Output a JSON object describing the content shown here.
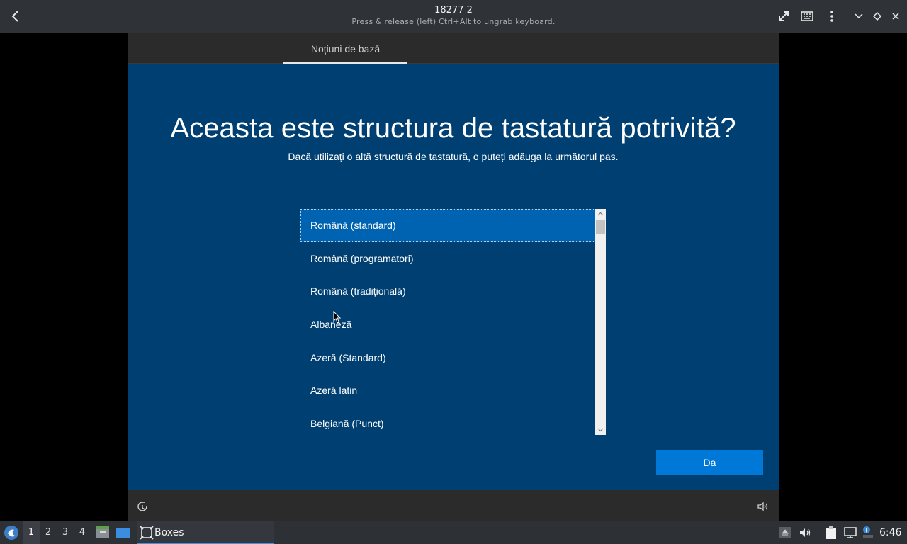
{
  "window": {
    "title": "18277 2",
    "subtitle": "Press & release (left) Ctrl+Alt to ungrab keyboard."
  },
  "setup": {
    "tab_label": "Noțiuni de bază",
    "heading": "Aceasta este structura de tastatură potrivită?",
    "subheading": "Dacă utilizați o altă structură de tastatură, o puteți adăuga la următorul pas.",
    "layouts": [
      "Română (standard)",
      "Română (programatori)",
      "Română (tradițională)",
      "Albaneză",
      "Azeră (Standard)",
      "Azeră latin",
      "Belgiană (Punct)"
    ],
    "selected_index": 0,
    "confirm_label": "Da"
  },
  "taskbar": {
    "workspaces": [
      "1",
      "2",
      "3",
      "4"
    ],
    "active_workspace": "1",
    "task_label": "Boxes",
    "clock": "6:46"
  },
  "colors": {
    "oobe_background": "#003f72",
    "selection": "#0063b1",
    "button": "#0078d7"
  }
}
